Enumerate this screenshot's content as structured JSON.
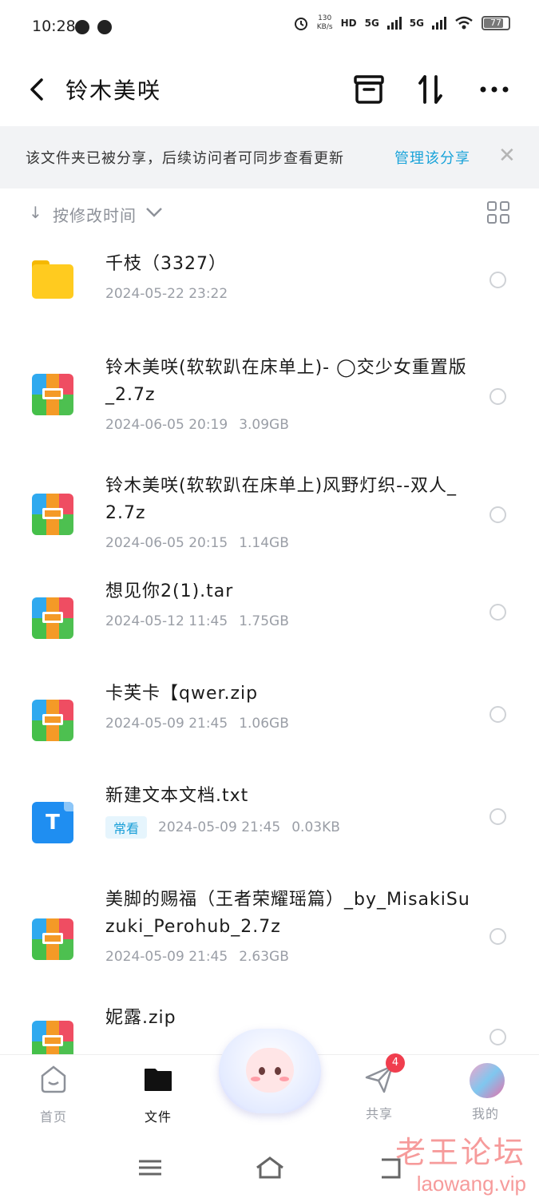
{
  "status_bar": {
    "time": "10:28",
    "net_speed_value": "130",
    "net_speed_unit": "KB/s",
    "hd_label": "HD",
    "signal1": "5G",
    "signal2": "5G",
    "battery": "77"
  },
  "header": {
    "title": "铃木美咲",
    "icons": [
      "back-icon",
      "archive-box-icon",
      "sort-swap-icon",
      "more-icon"
    ]
  },
  "banner": {
    "text": "该文件夹已被分享，后续访问者可同步查看更新",
    "link": "管理该分享",
    "close": "✕"
  },
  "sort": {
    "arrow": "↓",
    "label": "按修改时间"
  },
  "files": [
    {
      "icon": "folder",
      "name": "千枝（3327）",
      "date": "2024-05-22 23:22",
      "size": ""
    },
    {
      "icon": "archive",
      "name": "铃木美咲(软软趴在床单上)- ◯交少女重置版_2.7z",
      "date": "2024-06-05 20:19",
      "size": "3.09GB"
    },
    {
      "icon": "archive",
      "name": "铃木美咲(软软趴在床单上)风野灯织--双人_2.7z",
      "date": "2024-06-05 20:15",
      "size": "1.14GB"
    },
    {
      "icon": "archive",
      "name": "想见你2(1).tar",
      "date": "2024-05-12 11:45",
      "size": "1.75GB"
    },
    {
      "icon": "archive",
      "name": "卡芙卡【qwer.zip",
      "date": "2024-05-09 21:45",
      "size": "1.06GB"
    },
    {
      "icon": "text",
      "name": "新建文本文档.txt",
      "badge": "常看",
      "date": "2024-05-09 21:45",
      "size": "0.03KB"
    },
    {
      "icon": "archive",
      "name": "美脚的赐福（王者荣耀瑶篇）_by_MisakiSuzuki_Perohub_2.7z",
      "date": "2024-05-09 21:45",
      "size": "2.63GB"
    },
    {
      "icon": "archive",
      "name": "妮露.zip",
      "date": "",
      "size": ""
    }
  ],
  "bottom_nav": {
    "items": [
      {
        "label": "首页"
      },
      {
        "label": "文件"
      },
      {
        "label": "共享",
        "badge": "4"
      },
      {
        "label": "我的"
      }
    ]
  },
  "watermark": {
    "title": "老王论坛",
    "url": "laowang.vip"
  },
  "colors": {
    "accent": "#1aa3d9",
    "banner_bg": "#f2f3f5",
    "badge_red": "#f03e4e"
  }
}
